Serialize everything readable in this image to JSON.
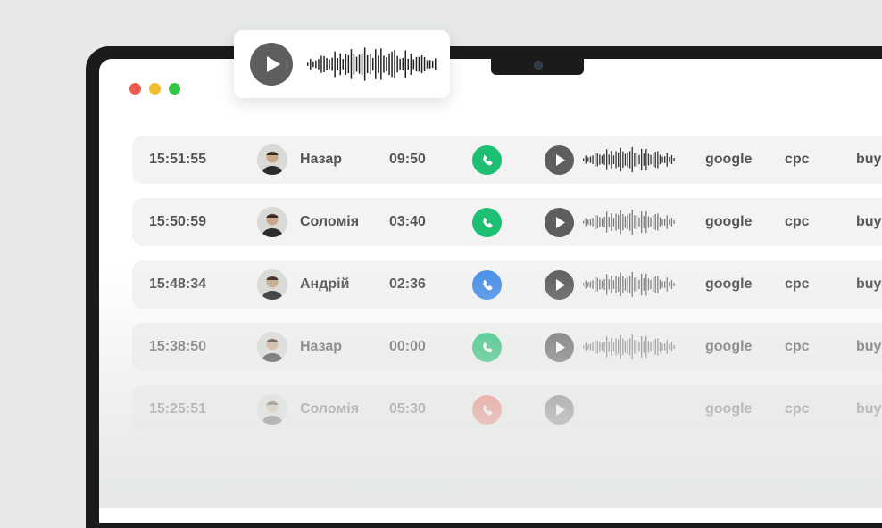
{
  "window_dots": [
    {
      "name": "close",
      "color": "#ee5a4f"
    },
    {
      "name": "minimize",
      "color": "#f4bd2e"
    },
    {
      "name": "maximize",
      "color": "#2fc845"
    }
  ],
  "player_card": {
    "icon": "play-icon",
    "waveform": "audio-waveform"
  },
  "calls": [
    {
      "time": "15:51:55",
      "name": "Назар",
      "duration": "09:50",
      "call_color": "#1dbf73",
      "source": "google",
      "medium": "cpc",
      "campaign": "buy",
      "waveform": true,
      "opacity": 1
    },
    {
      "time": "15:50:59",
      "name": "Соломія",
      "duration": "03:40",
      "call_color": "#1dbf73",
      "source": "google",
      "medium": "cpc",
      "campaign": "buy",
      "waveform": true,
      "opacity": 1
    },
    {
      "time": "15:48:34",
      "name": "Андрій",
      "duration": "02:36",
      "call_color": "#4a8fe7",
      "source": "google",
      "medium": "cpc",
      "campaign": "buy",
      "waveform": true,
      "opacity": 1
    },
    {
      "time": "15:38:50",
      "name": "Назар",
      "duration": "00:00",
      "call_color": "#1dbf73",
      "source": "google",
      "medium": "cpc",
      "campaign": "buy",
      "waveform": true,
      "opacity": 1
    },
    {
      "time": "15:25:51",
      "name": "Соломія",
      "duration": "05:30",
      "call_color": "#ee5a4f",
      "source": "google",
      "medium": "cpc",
      "campaign": "buy",
      "waveform": false,
      "opacity": 1
    }
  ]
}
